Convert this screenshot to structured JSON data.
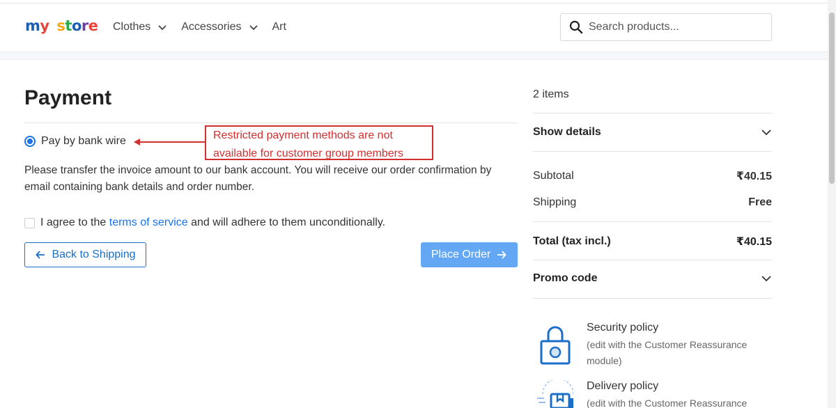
{
  "header": {
    "logo": {
      "part1": "my",
      "part2": "store"
    },
    "nav": [
      {
        "label": "Clothes",
        "has_dropdown": true
      },
      {
        "label": "Accessories",
        "has_dropdown": true
      },
      {
        "label": "Art",
        "has_dropdown": false
      }
    ],
    "search": {
      "placeholder": "Search products..."
    }
  },
  "payment": {
    "title": "Payment",
    "option_label": "Pay by bank wire",
    "option_selected": true,
    "callout": {
      "line1": "Restricted payment methods are not",
      "line2": "available for customer group members"
    },
    "description": "Please transfer the invoice amount to our bank account. You will receive our order confirmation by email containing bank details and order number.",
    "agree": {
      "prefix": "I agree to the",
      "link": "terms of service",
      "suffix": "and will adhere to them unconditionally."
    },
    "back_button": "Back to Shipping",
    "place_button": "Place Order"
  },
  "summary": {
    "items_count": "2 items",
    "show_details": "Show details",
    "subtotal_label": "Subtotal",
    "subtotal_value": "₹40.15",
    "shipping_label": "Shipping",
    "shipping_value": "Free",
    "total_label": "Total (tax incl.)",
    "total_value": "₹40.15",
    "promo_label": "Promo code"
  },
  "reassurance": [
    {
      "title": "Security policy",
      "subtitle": "(edit with the Customer Reassurance module)",
      "icon": "lock-icon"
    },
    {
      "title": "Delivery policy",
      "subtitle": "(edit with the Customer Reassurance module)",
      "icon": "delivery-icon"
    }
  ],
  "colors": {
    "accent": "#1a73e8",
    "place_order_bg": "#64a8f5",
    "callout_red": "#d32f2f",
    "logo_colors": [
      "#1a5fb4",
      "#e8453c",
      "#f3a712",
      "#2aa84a",
      "#6b3fa0"
    ]
  }
}
